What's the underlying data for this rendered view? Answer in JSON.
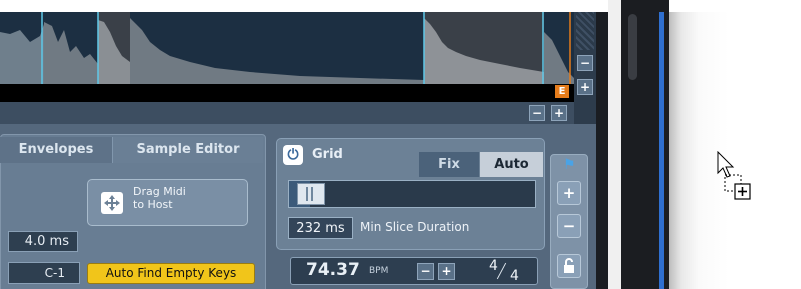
{
  "waveform": {
    "marker_label": "E"
  },
  "scroll_buttons": {
    "minus": "−",
    "plus": "+"
  },
  "tabs": [
    {
      "label": "Envelopes"
    },
    {
      "label": "Sample Editor"
    }
  ],
  "drag_midi": {
    "line1": "Drag Midi",
    "line2": "to Host"
  },
  "fields": {
    "ms_value": "4.0 ms",
    "note_value": "C-1"
  },
  "auto_find_keys": {
    "label": "Auto Find Empty Keys"
  },
  "grid": {
    "title": "Grid",
    "power_icon": "power-icon",
    "modes": {
      "fix": "Fix",
      "auto": "Auto",
      "selected": "Auto"
    },
    "slider_level": 0.03,
    "slice_ms": "232 ms",
    "slice_label": "Min Slice Duration"
  },
  "tempo": {
    "bpm": "74.37",
    "unit": "BPM",
    "minus": "−",
    "plus": "+",
    "sig_num": "4",
    "sig_den": "4"
  },
  "tools": {
    "plus": "+",
    "minus": "−",
    "icons": [
      "flag-icon",
      "plus-icon",
      "minus-icon",
      "lock-icon"
    ]
  },
  "colors": {
    "accent": "#e57c1b",
    "highlight": "#f1c51a",
    "waveform_line": "#5fc8e8",
    "host_blue": "#2f6fcf"
  }
}
